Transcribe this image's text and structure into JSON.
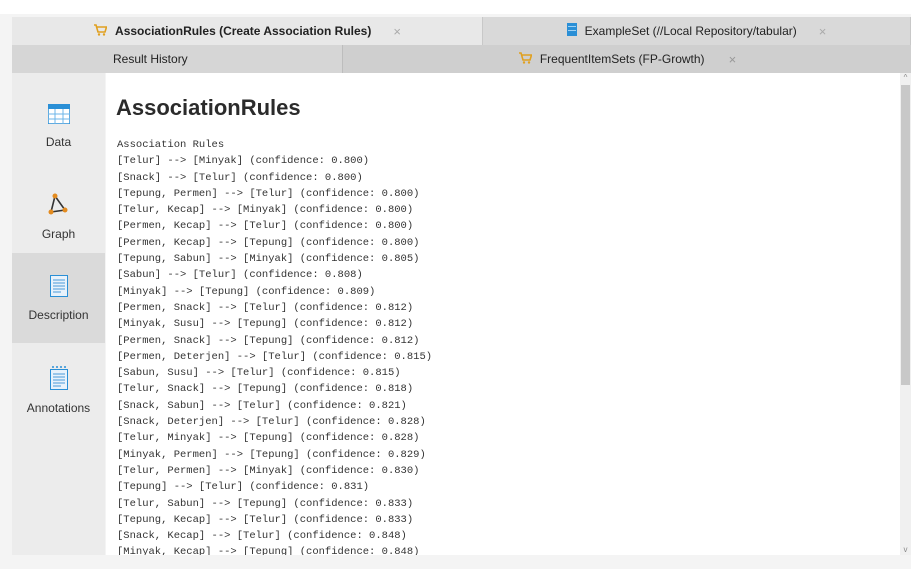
{
  "tabs": {
    "active": {
      "label": "AssociationRules (Create Association Rules)",
      "close": "×"
    },
    "inactive": {
      "label": "ExampleSet (//Local Repository/tabular)",
      "close": "×"
    }
  },
  "subtabs": {
    "history": "Result History",
    "freq": {
      "label": "FrequentItemSets (FP-Growth)",
      "close": "×"
    }
  },
  "sidebar": {
    "items": [
      {
        "label": "Data",
        "icon": "table-icon"
      },
      {
        "label": "Graph",
        "icon": "graph-icon"
      },
      {
        "label": "Description",
        "icon": "document-icon"
      },
      {
        "label": "Annotations",
        "icon": "annotation-icon"
      }
    ]
  },
  "content": {
    "title": "AssociationRules",
    "heading": "Association Rules",
    "rules": [
      "[Telur] --> [Minyak] (confidence: 0.800)",
      "[Snack] --> [Telur] (confidence: 0.800)",
      "[Tepung, Permen] --> [Telur] (confidence: 0.800)",
      "[Telur, Kecap] --> [Minyak] (confidence: 0.800)",
      "[Permen, Kecap] --> [Telur] (confidence: 0.800)",
      "[Permen, Kecap] --> [Tepung] (confidence: 0.800)",
      "[Tepung, Sabun] --> [Minyak] (confidence: 0.805)",
      "[Sabun] --> [Telur] (confidence: 0.808)",
      "[Minyak] --> [Tepung] (confidence: 0.809)",
      "[Permen, Snack] --> [Telur] (confidence: 0.812)",
      "[Minyak, Susu] --> [Tepung] (confidence: 0.812)",
      "[Permen, Snack] --> [Tepung] (confidence: 0.812)",
      "[Permen, Deterjen] --> [Telur] (confidence: 0.815)",
      "[Sabun, Susu] --> [Telur] (confidence: 0.815)",
      "[Telur, Snack] --> [Tepung] (confidence: 0.818)",
      "[Snack, Sabun] --> [Telur] (confidence: 0.821)",
      "[Snack, Deterjen] --> [Telur] (confidence: 0.828)",
      "[Telur, Minyak] --> [Tepung] (confidence: 0.828)",
      "[Minyak, Permen] --> [Tepung] (confidence: 0.829)",
      "[Telur, Permen] --> [Minyak] (confidence: 0.830)",
      "[Tepung] --> [Telur] (confidence: 0.831)",
      "[Telur, Sabun] --> [Tepung] (confidence: 0.833)",
      "[Tepung, Kecap] --> [Telur] (confidence: 0.833)",
      "[Snack, Kecap] --> [Telur] (confidence: 0.848)",
      "[Minyak, Kecap] --> [Tepung] (confidence: 0.848)"
    ]
  },
  "colors": {
    "accent": "#2a73c9",
    "cart": "#e0a020"
  }
}
